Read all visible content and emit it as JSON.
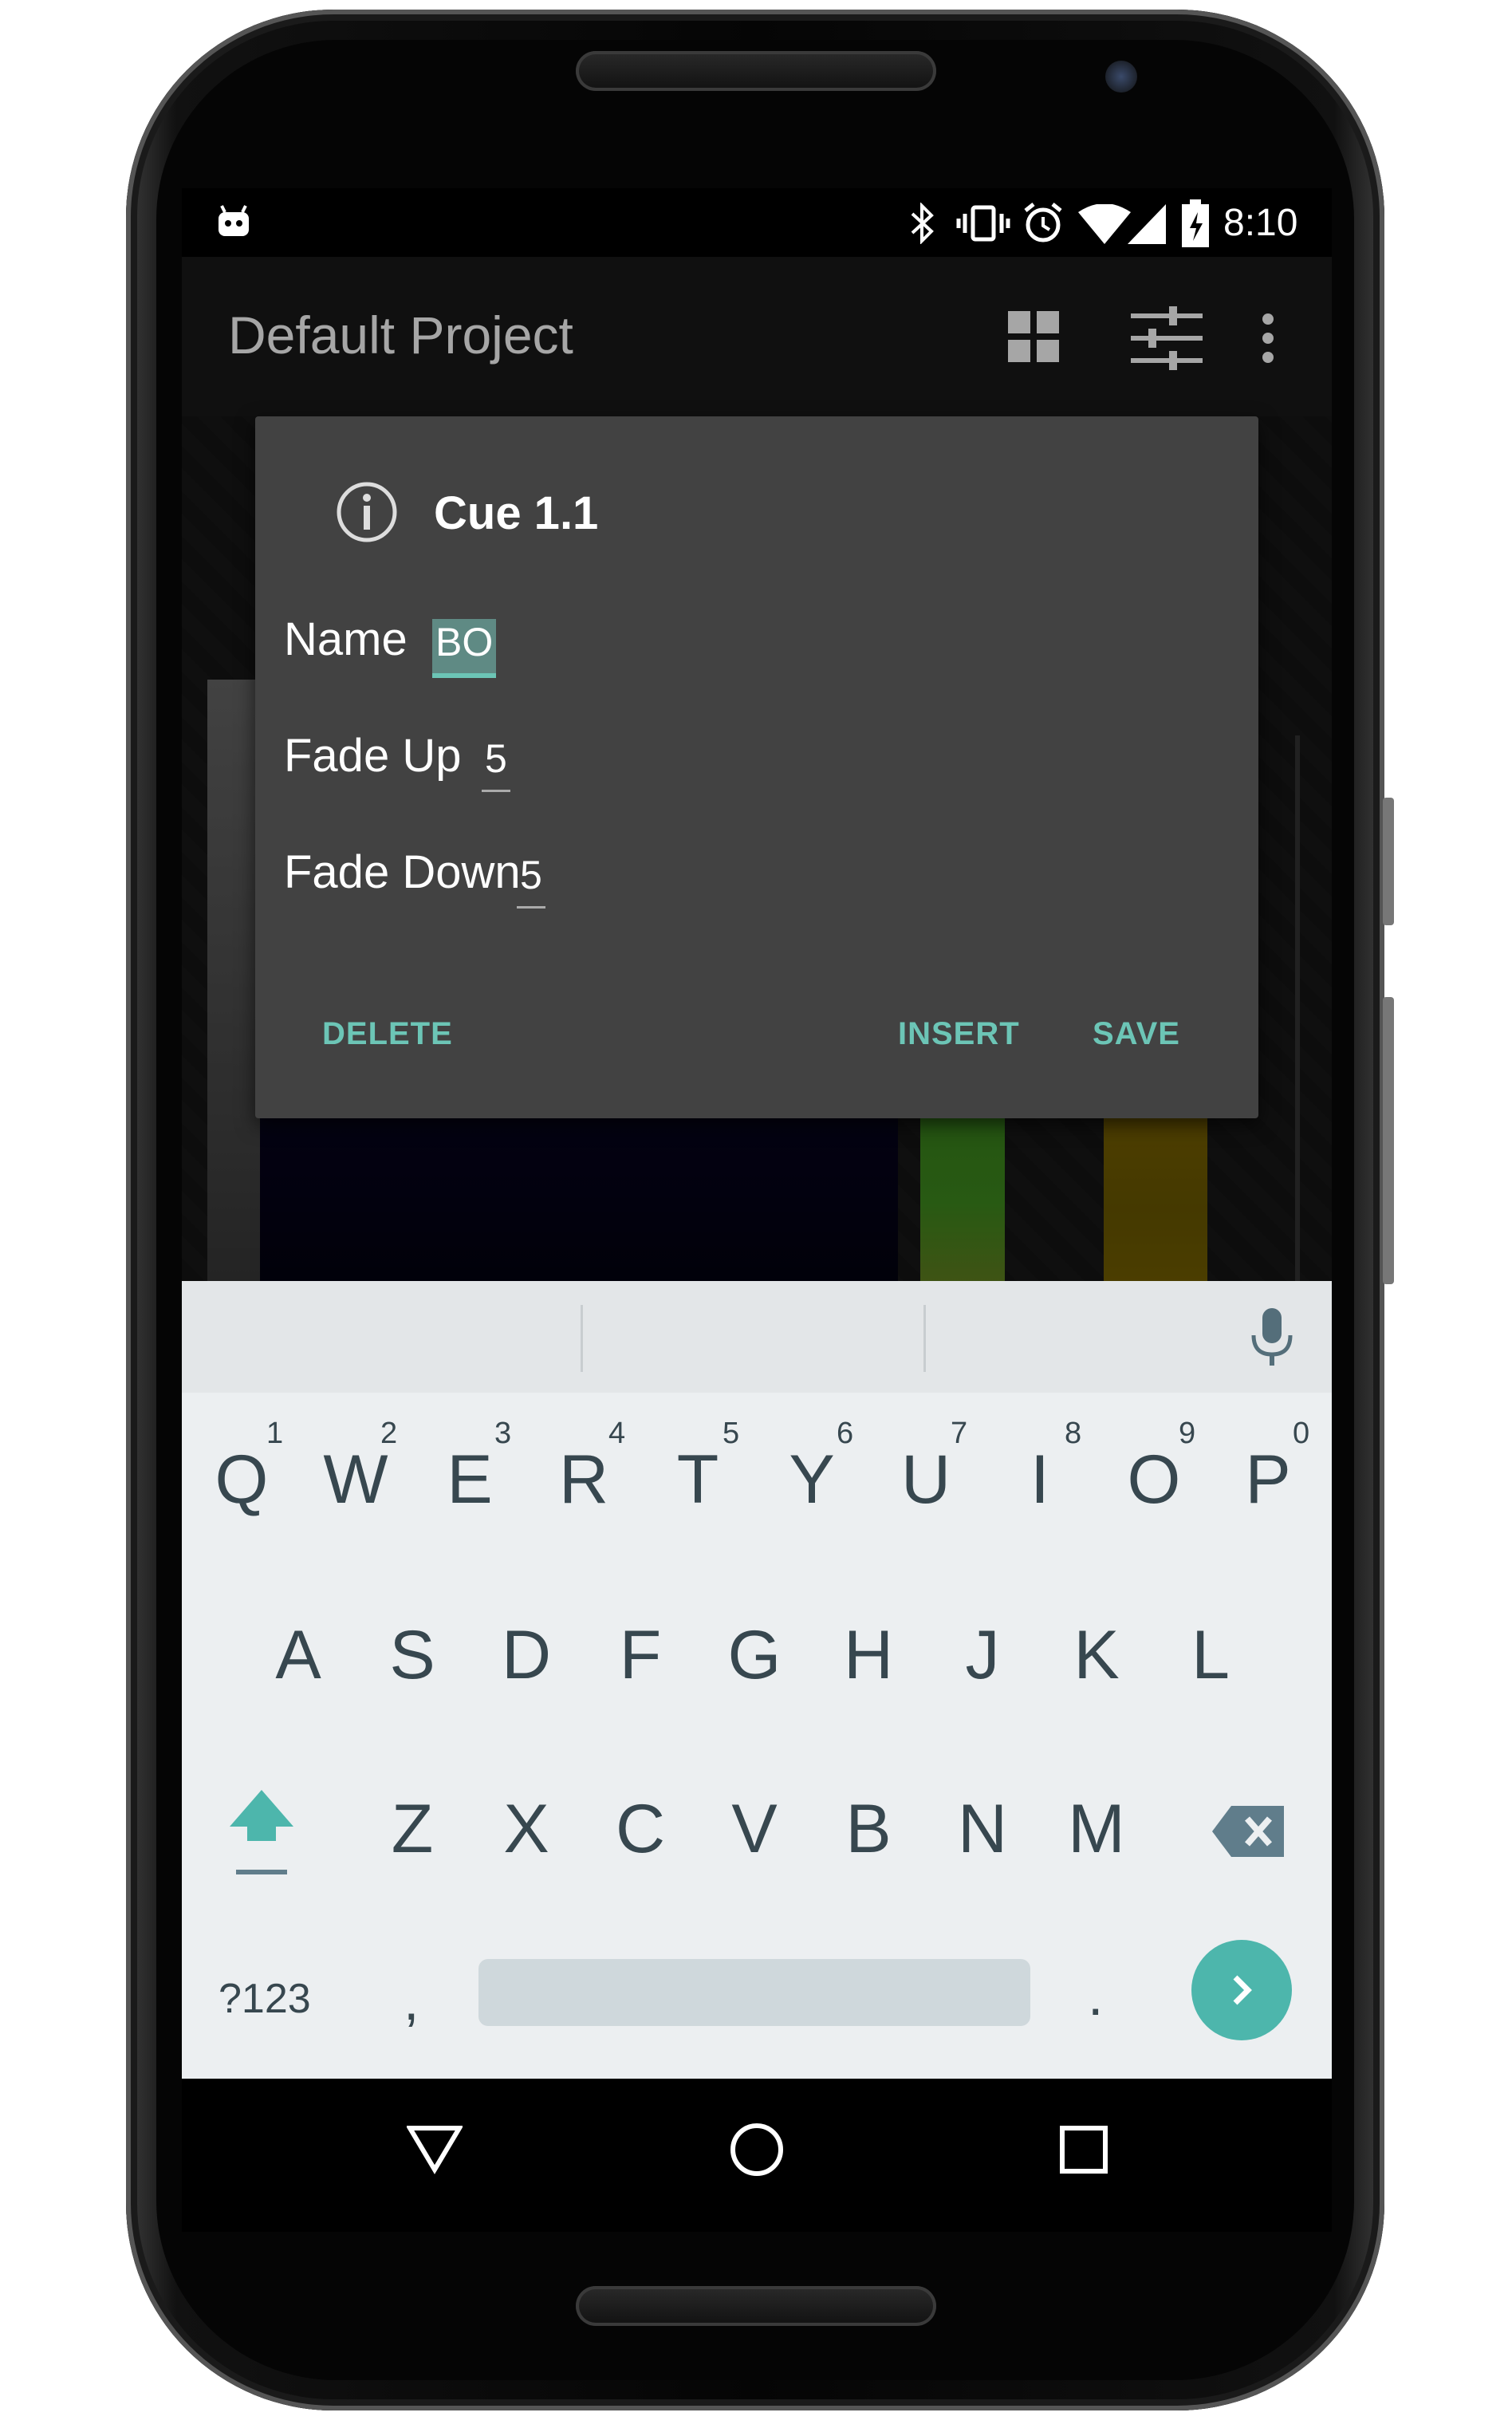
{
  "status_bar": {
    "time": "8:10",
    "icons": [
      "android-icon",
      "bluetooth-icon",
      "vibrate-icon",
      "alarm-icon",
      "wifi-icon",
      "signal-icon",
      "battery-icon"
    ]
  },
  "app_bar": {
    "title": "Default Project",
    "actions": [
      "grid-icon",
      "sliders-icon",
      "more-vert-icon"
    ]
  },
  "dialog": {
    "title": "Cue 1.1",
    "name_label": "Name",
    "name_value": "BO",
    "fade_up_label": "Fade Up",
    "fade_up_value": "5",
    "fade_down_label": "Fade Down",
    "fade_down_value": "5",
    "delete_label": "DELETE",
    "insert_label": "INSERT",
    "save_label": "SAVE"
  },
  "keyboard": {
    "row1": [
      "Q",
      "W",
      "E",
      "R",
      "T",
      "Y",
      "U",
      "I",
      "O",
      "P"
    ],
    "row1_hints": [
      "1",
      "2",
      "3",
      "4",
      "5",
      "6",
      "7",
      "8",
      "9",
      "0"
    ],
    "row2": [
      "A",
      "S",
      "D",
      "F",
      "G",
      "H",
      "J",
      "K",
      "L"
    ],
    "row3": [
      "Z",
      "X",
      "C",
      "V",
      "B",
      "N",
      "M"
    ],
    "symbols_label": "?123",
    "comma": ",",
    "period": ".",
    "accent_color": "#4db6ac"
  },
  "colors": {
    "dialog_bg": "#424242",
    "accent": "#6cc5b6",
    "keyboard_bg": "#eceff1",
    "key_text": "#37474f"
  }
}
